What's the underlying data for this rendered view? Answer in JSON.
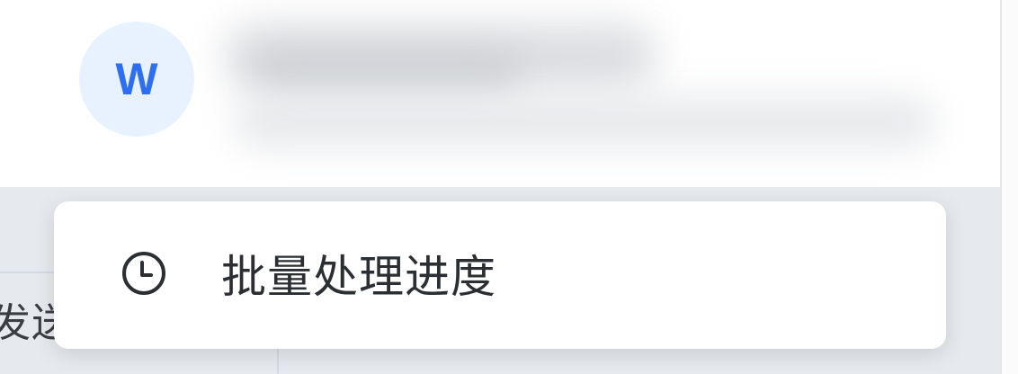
{
  "user": {
    "avatar_initial": "W"
  },
  "popup_menu": {
    "items": [
      {
        "label": "批量处理进度",
        "icon": "clock-icon"
      }
    ]
  },
  "background": {
    "partial_text": "发送短消息"
  },
  "colors": {
    "avatar_bg": "#e8f2ff",
    "avatar_text": "#2e6ef0",
    "menu_text": "#2b2e33",
    "dim_overlay": "#e6e9ee"
  }
}
